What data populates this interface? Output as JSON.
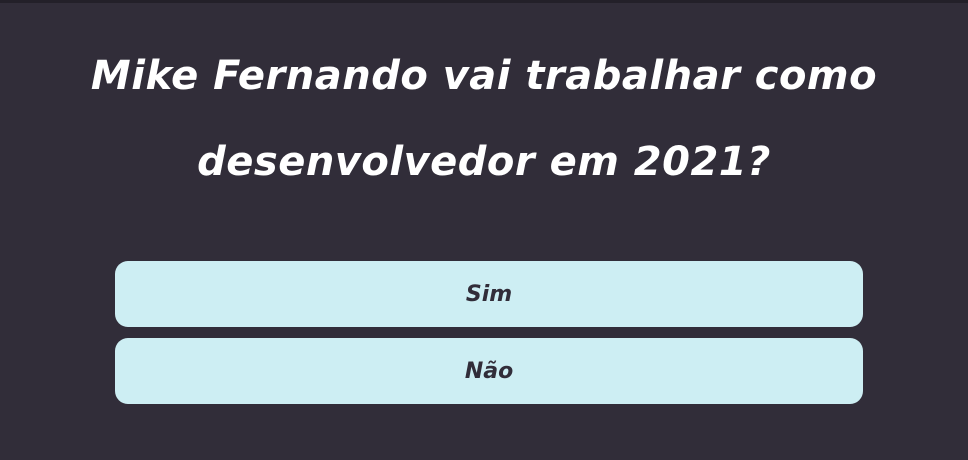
{
  "poll": {
    "question_line1": "Mike Fernando vai trabalhar como",
    "question_line2": "desenvolvedor em 2021?",
    "options": [
      {
        "label": "Sim"
      },
      {
        "label": "Não"
      }
    ]
  },
  "colors": {
    "background": "#312d39",
    "top_border": "#232029",
    "question_text": "#ffffff",
    "button_background": "#cdeef3",
    "button_text": "#312d39"
  }
}
